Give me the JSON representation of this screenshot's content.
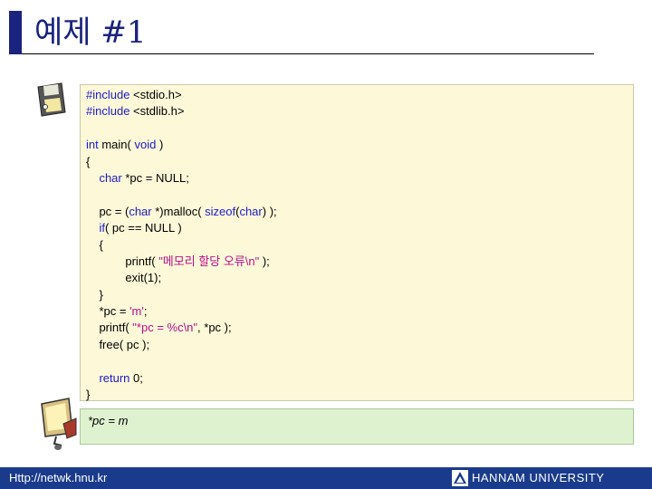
{
  "slide": {
    "title": "예제 #1"
  },
  "code": {
    "lines": [
      {
        "t": "#include <stdio.h>"
      },
      {
        "t": "#include <stdlib.h>"
      },
      {
        "t": ""
      },
      {
        "t": "int main( void )"
      },
      {
        "t": "{"
      },
      {
        "t": "    char *pc = NULL;"
      },
      {
        "t": ""
      },
      {
        "t": "    pc = (char *)malloc( sizeof(char) );"
      },
      {
        "t": "    if( pc == NULL )"
      },
      {
        "t": "    {"
      },
      {
        "t": "            printf( \"메모리 할당 오류\\n\" );"
      },
      {
        "t": "            exit(1);"
      },
      {
        "t": "    }"
      },
      {
        "t": "    *pc = 'm';"
      },
      {
        "t": "    printf( \"*pc = %c\\n\", *pc );"
      },
      {
        "t": "    free( pc );"
      },
      {
        "t": ""
      },
      {
        "t": "    return 0;"
      },
      {
        "t": "}"
      }
    ]
  },
  "output": {
    "text": "*pc = m"
  },
  "footer": {
    "url": "Http://netwk.hnu.kr",
    "university": "HANNAM UNIVERSITY"
  },
  "colors": {
    "accent": "#1a237e",
    "code_background": "#fdf8d8",
    "output_background": "#dff2cf",
    "footer_background": "#1a3b8c",
    "keyword": "#1b1bcc",
    "string": "#b5108c"
  },
  "icons": {
    "code_icon": "floppy-disk-icon",
    "output_icon": "monitor-icon",
    "logo": "hannam-logo-icon"
  }
}
